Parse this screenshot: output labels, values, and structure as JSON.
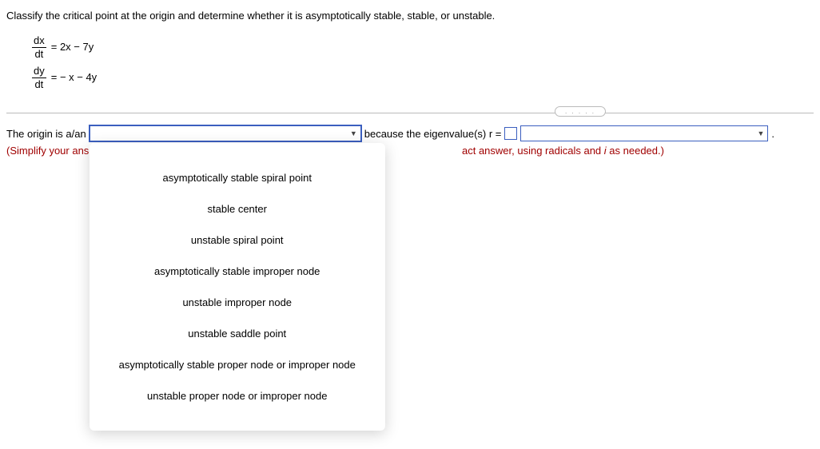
{
  "question": "Classify the critical point at the origin and determine whether it is asymptotically stable, stable, or unstable.",
  "eq1": {
    "num": "dx",
    "den": "dt",
    "rhs": "= 2x − 7y"
  },
  "eq2": {
    "num": "dy",
    "den": "dt",
    "rhs": "= − x − 4y"
  },
  "dots": ". . . . .",
  "answer": {
    "prefix": "The origin is a/an",
    "mid1": "because the eigenvalue(s) r =",
    "end": "."
  },
  "hint": {
    "start": "(Simplify your ans",
    "end_a": "act answer, using radicals and ",
    "end_i": "i",
    "end_b": " as needed.)"
  },
  "options": [
    "asymptotically stable spiral point",
    "stable center",
    "unstable spiral point",
    "asymptotically stable improper node",
    "unstable improper node",
    "unstable saddle point",
    "asymptotically stable proper node or improper node",
    "unstable proper node or improper node"
  ],
  "arrow": "▼"
}
